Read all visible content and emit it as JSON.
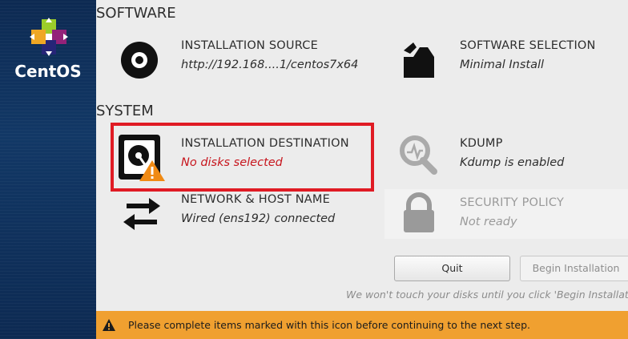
{
  "brand": {
    "name": "CentOS"
  },
  "sections": {
    "software": "SOFTWARE",
    "system": "SYSTEM"
  },
  "spokes": {
    "installation_source": {
      "title": "INSTALLATION SOURCE",
      "status": "http://192.168....1/centos7x64",
      "icon": "disc-icon"
    },
    "software_selection": {
      "title": "SOFTWARE SELECTION",
      "status": "Minimal Install",
      "icon": "package-icon"
    },
    "installation_destination": {
      "title": "INSTALLATION DESTINATION",
      "status": "No disks selected",
      "icon": "hard-disk-warning-icon"
    },
    "kdump": {
      "title": "KDUMP",
      "status": "Kdump is enabled",
      "icon": "magnifier-icon"
    },
    "network": {
      "title": "NETWORK & HOST NAME",
      "status": "Wired (ens192) connected",
      "icon": "network-arrows-icon"
    },
    "security_policy": {
      "title": "SECURITY POLICY",
      "status": "Not ready",
      "icon": "lock-icon"
    }
  },
  "buttons": {
    "quit": "Quit",
    "begin": "Begin Installation"
  },
  "note": "We won't touch your disks until you click 'Begin Installation'.",
  "warning": {
    "text": "Please complete items marked with this icon before continuing to the next step."
  },
  "colors": {
    "sidebar": "#0d2a52",
    "warning_bar": "#f0a030",
    "error_text": "#c7161e",
    "highlight_border": "#e01b24"
  }
}
